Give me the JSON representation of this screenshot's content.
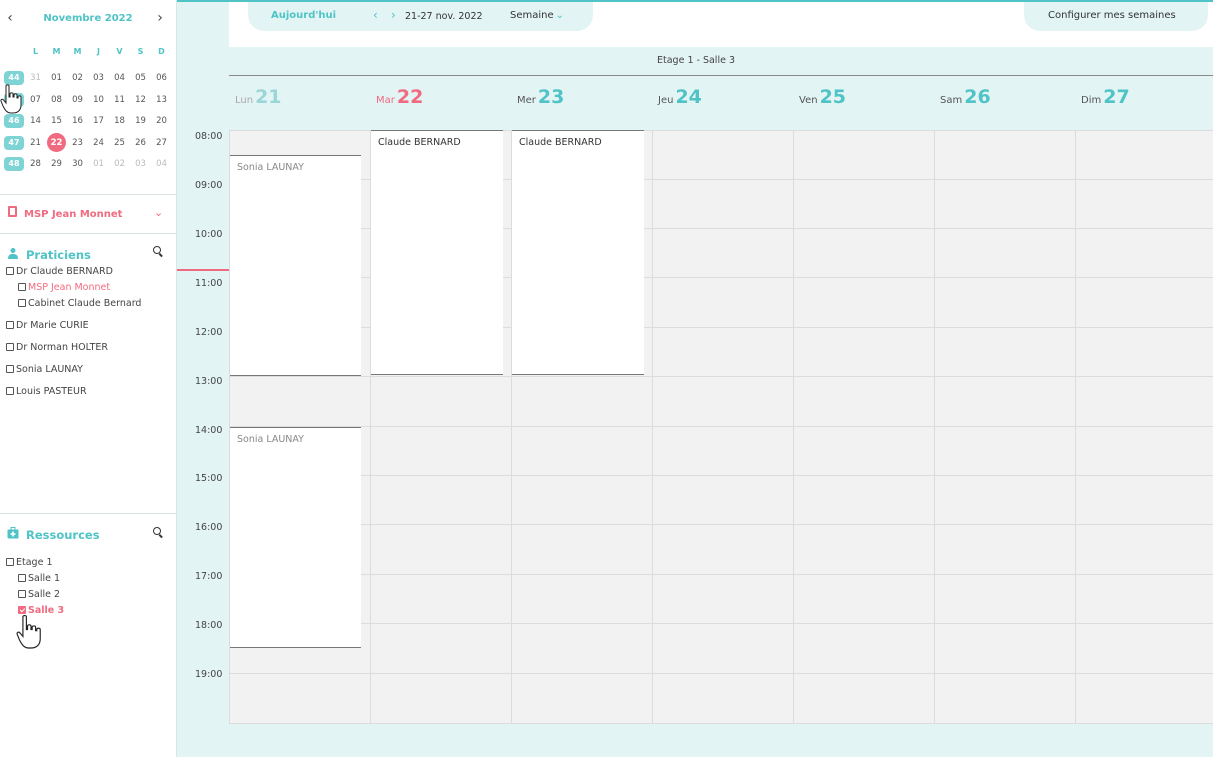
{
  "mini_calendar": {
    "month_label": "Novembre 2022",
    "prev": "‹",
    "next": "›",
    "weekdays": [
      "L",
      "M",
      "M",
      "J",
      "V",
      "S",
      "D"
    ],
    "weeks": [
      {
        "week": "44",
        "days": [
          "31",
          "01",
          "02",
          "03",
          "04",
          "05",
          "06"
        ]
      },
      {
        "week": "45",
        "days": [
          "07",
          "08",
          "09",
          "10",
          "11",
          "12",
          "13"
        ]
      },
      {
        "week": "46",
        "days": [
          "14",
          "15",
          "16",
          "17",
          "18",
          "19",
          "20"
        ]
      },
      {
        "week": "47",
        "days": [
          "21",
          "22",
          "23",
          "24",
          "25",
          "26",
          "27"
        ]
      },
      {
        "week": "48",
        "days": [
          "28",
          "29",
          "30",
          "01",
          "02",
          "03",
          "04"
        ]
      }
    ],
    "today": "22"
  },
  "site": {
    "label": "MSP Jean Monnet",
    "chevron": "⌄"
  },
  "practitioners": {
    "title": "Praticiens",
    "items": [
      {
        "label": "Dr Claude BERNARD"
      },
      {
        "label": "MSP Jean Monnet"
      },
      {
        "label": "Cabinet Claude Bernard"
      },
      {
        "label": "Dr Marie CURIE"
      },
      {
        "label": "Dr Norman HOLTER"
      },
      {
        "label": "Sonia LAUNAY"
      },
      {
        "label": "Louis PASTEUR"
      }
    ]
  },
  "resources": {
    "title": "Ressources",
    "items": [
      {
        "label": "Etage 1"
      },
      {
        "label": "Salle 1"
      },
      {
        "label": "Salle 2"
      },
      {
        "label": "Salle 3"
      }
    ]
  },
  "toolbar": {
    "today_label": "Aujourd'hui",
    "prev": "‹",
    "next": "›",
    "date_range": "21-27 nov. 2022",
    "view_label": "Semaine",
    "view_chevron": "⌄",
    "configure_label": "Configurer mes semaines"
  },
  "room_title": "Etage 1 - Salle 3",
  "days": [
    {
      "name": "Lun",
      "num": "21"
    },
    {
      "name": "Mar",
      "num": "22"
    },
    {
      "name": "Mer",
      "num": "23"
    },
    {
      "name": "Jeu",
      "num": "24"
    },
    {
      "name": "Ven",
      "num": "25"
    },
    {
      "name": "Sam",
      "num": "26"
    },
    {
      "name": "Dim",
      "num": "27"
    }
  ],
  "hours": [
    "08:00",
    "09:00",
    "10:00",
    "11:00",
    "12:00",
    "13:00",
    "14:00",
    "15:00",
    "16:00",
    "17:00",
    "18:00",
    "19:00"
  ],
  "events": [
    {
      "label": "Sonia LAUNAY"
    },
    {
      "label": "Claude BERNARD"
    },
    {
      "label": "Claude BERNARD"
    },
    {
      "label": "Sonia LAUNAY"
    }
  ],
  "colors": {
    "accent": "#4fc3c5",
    "pink": "#f06b80",
    "light_bg": "#e3f4f5"
  }
}
